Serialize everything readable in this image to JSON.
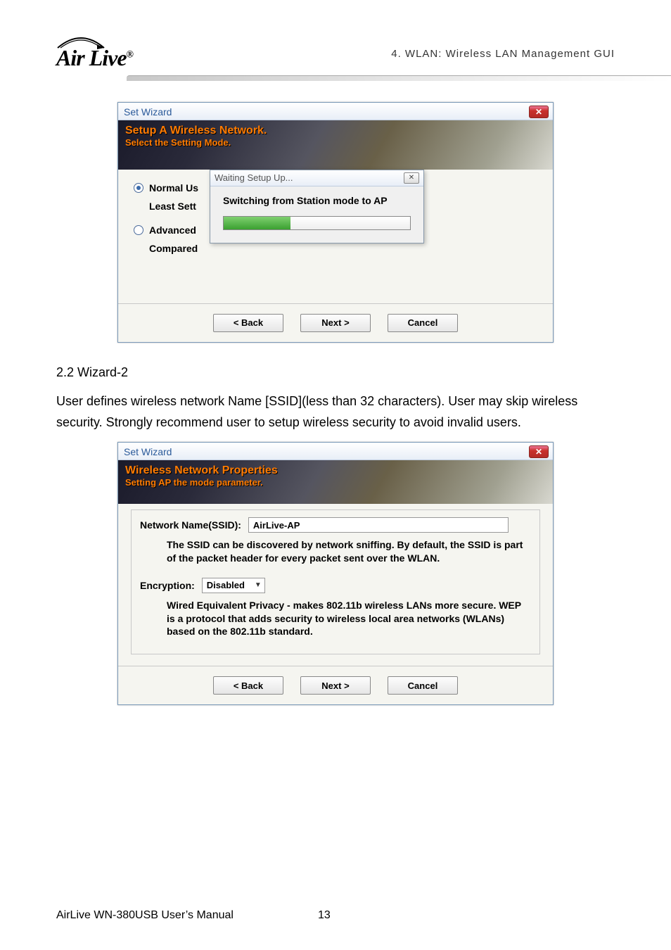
{
  "header": {
    "logo_top": "Air Live",
    "chapter": "4. WLAN: Wireless LAN Management GUI"
  },
  "dialog1": {
    "window_title": "Set Wizard",
    "banner_title": "Setup A Wireless Network.",
    "banner_subtitle": "Select the Setting Mode.",
    "opt1_label": "Normal Us",
    "opt1_desc": "Least Sett",
    "opt2_label": "Advanced",
    "opt2_desc": "Compared",
    "popup_title": "Waiting Setup Up...",
    "popup_msg": "Switching from Station mode to AP",
    "btn_back": "< Back",
    "btn_next": "Next >",
    "btn_cancel": "Cancel"
  },
  "section": {
    "heading": "2.2 Wizard-2",
    "paragraph": "User defines wireless network Name [SSID](less than 32 characters). User may skip wireless security. Strongly recommend user to setup wireless security to avoid invalid users."
  },
  "dialog2": {
    "window_title": "Set Wizard",
    "banner_title": "Wireless Network Properties",
    "banner_subtitle": "Setting AP the mode parameter.",
    "ssid_label": "Network Name(SSID):",
    "ssid_value": "AirLive-AP",
    "ssid_desc": "The SSID can be discovered by network sniffing. By default, the SSID is part of the packet header for every packet sent over the WLAN.",
    "enc_label": "Encryption:",
    "enc_value": "Disabled",
    "enc_desc": "Wired Equivalent Privacy - makes 802.11b wireless LANs more secure. WEP is a protocol that adds security to wireless local area networks (WLANs) based on the 802.11b standard.",
    "btn_back": "< Back",
    "btn_next": "Next >",
    "btn_cancel": "Cancel"
  },
  "footer": {
    "left": "AirLive WN-380USB User’s Manual",
    "page": "13"
  }
}
